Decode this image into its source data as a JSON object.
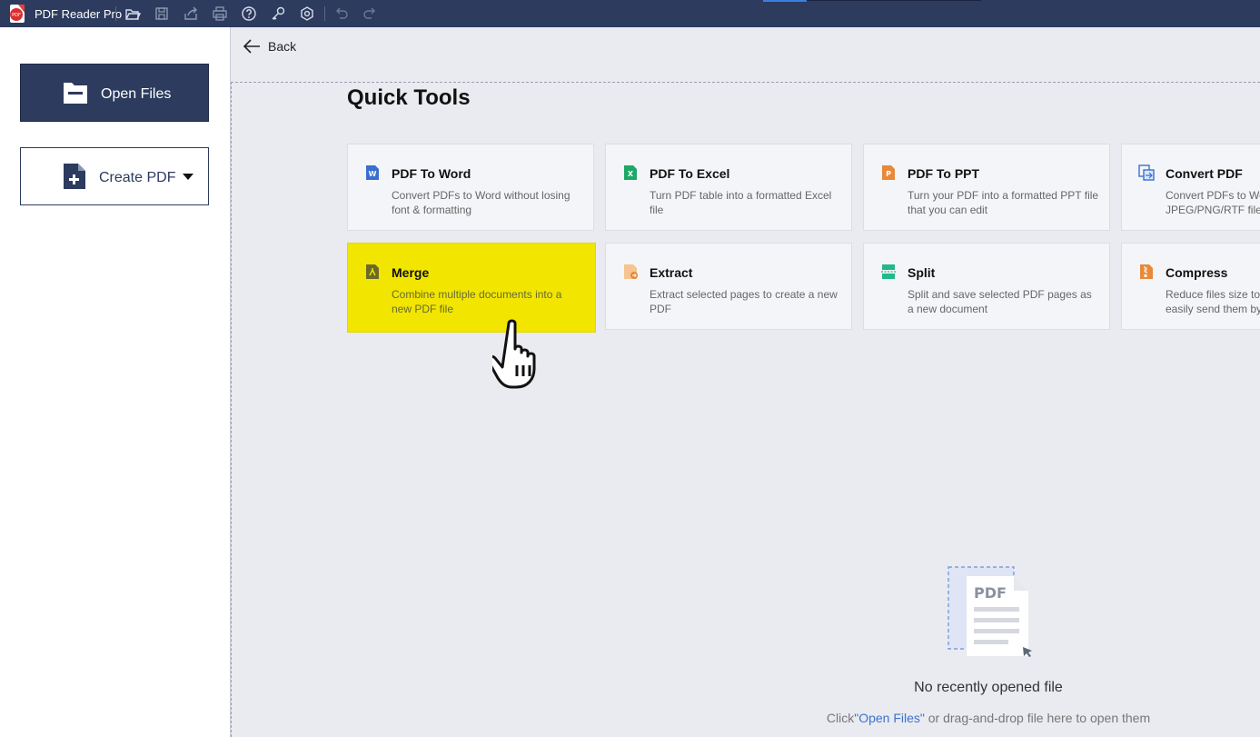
{
  "app": {
    "name": "PDF Reader Pro"
  },
  "toolbar": {
    "icons": [
      "open-folder-icon",
      "save-icon",
      "share-icon",
      "print-icon",
      "help-icon",
      "key-icon",
      "settings-icon",
      "undo-icon",
      "redo-icon"
    ]
  },
  "sidebar": {
    "open_files": "Open Files",
    "create_pdf": "Create PDF"
  },
  "main": {
    "back": "Back",
    "title": "Quick Tools",
    "tools": [
      {
        "name": "PDF To Word",
        "desc": "Convert PDFs to Word without losing font & formatting",
        "icon": "word-icon",
        "color": "#3a6fd0"
      },
      {
        "name": "PDF To Excel",
        "desc": "Turn PDF table into a formatted Excel file",
        "icon": "excel-icon",
        "color": "#1ea868"
      },
      {
        "name": "PDF To PPT",
        "desc": "Turn your PDF into a formatted PPT file that you can edit",
        "icon": "ppt-icon",
        "color": "#e8893a"
      },
      {
        "name": "Convert PDF",
        "desc": "Convert PDFs to Wo JPEG/PNG/RTF files",
        "icon": "convert-icon",
        "color": "#3a6fd0"
      },
      {
        "name": "Merge",
        "desc": "Combine multiple documents into a new PDF file",
        "icon": "merge-icon",
        "color": "#6b6a2a",
        "highlighted": true
      },
      {
        "name": "Extract",
        "desc": "Extract selected pages to create a new PDF",
        "icon": "extract-icon",
        "color": "#f0a050"
      },
      {
        "name": "Split",
        "desc": "Split and save selected PDF pages as a new document",
        "icon": "split-icon",
        "color": "#22b888"
      },
      {
        "name": "Compress",
        "desc": "Reduce files size to easily send them by",
        "icon": "compress-icon",
        "color": "#e8893a"
      }
    ],
    "empty": {
      "art_label": "PDF",
      "title": "No recently opened file",
      "hint_prefix": "Click",
      "hint_link": "\"Open Files\"",
      "hint_suffix": " or drag-and-drop file here to open them"
    }
  },
  "colors": {
    "titlebar": "#2c3b5e",
    "background": "#eaeaf1",
    "highlight": "#f2e600",
    "link": "#3a74c9"
  }
}
